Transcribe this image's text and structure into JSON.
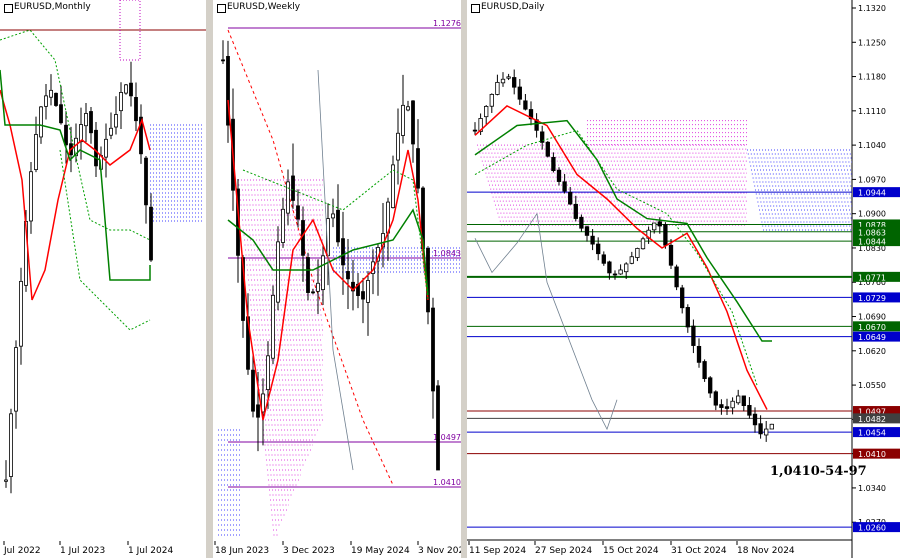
{
  "panels": [
    {
      "id": "monthly",
      "title": "EURUSD,Monthly",
      "x_labels": [
        "Jul 2022",
        "1 Jul 2023",
        "1 Jul 2024"
      ],
      "chart_data": {
        "type": "candlestick",
        "timeframe": "Monthly"
      }
    },
    {
      "id": "weekly",
      "title": "EURUSD,Weekly",
      "x_labels": [
        "18 Jun 2023",
        "3 Dec 2023",
        "19 May 2024",
        "3 Nov 2024"
      ],
      "level_labels": [
        "1.1276",
        "1.0843",
        "1.0497",
        "1.0410"
      ],
      "chart_data": {
        "type": "candlestick",
        "timeframe": "Weekly"
      }
    },
    {
      "id": "daily",
      "title": "EURUSD,Daily",
      "x_labels": [
        "11 Sep 2024",
        "27 Sep 2024",
        "15 Oct 2024",
        "31 Oct 2024",
        "18 Nov 2024"
      ],
      "annotation": "1,0410-54-97",
      "chart_data": {
        "type": "candlestick",
        "timeframe": "Daily",
        "ylim": [
          1.025,
          1.132
        ],
        "y_ticks": [
          "1.1320",
          "1.1250",
          "1.1180",
          "1.1110",
          "1.1040",
          "1.0970",
          "1.0900",
          "1.0830",
          "1.0760",
          "1.0690",
          "1.0620",
          "1.0550",
          "1.0480",
          "1.0410",
          "1.0340",
          "1.0270"
        ],
        "levels": [
          {
            "label": "1.0944",
            "value": 1.0944,
            "color": "#0000cc"
          },
          {
            "label": "1.0878",
            "value": 1.0878,
            "color": "#006400"
          },
          {
            "label": "1.0863",
            "value": 1.0863,
            "color": "#006400"
          },
          {
            "label": "1.0844",
            "value": 1.0844,
            "color": "#006400"
          },
          {
            "label": "1.0771",
            "value": 1.0771,
            "color": "#006400"
          },
          {
            "label": "1.0729",
            "value": 1.0729,
            "color": "#0000cc"
          },
          {
            "label": "1.0670",
            "value": 1.067,
            "color": "#006400"
          },
          {
            "label": "1.0649",
            "value": 1.0649,
            "color": "#0000cc"
          },
          {
            "label": "1.0497",
            "value": 1.0497,
            "color": "#8b0000"
          },
          {
            "label": "1.0482",
            "value": 1.0482,
            "color": "#404040"
          },
          {
            "label": "1.0454",
            "value": 1.0454,
            "color": "#0000cc"
          },
          {
            "label": "1.0410",
            "value": 1.041,
            "color": "#8b0000"
          },
          {
            "label": "1.0260",
            "value": 1.026,
            "color": "#0000cc"
          }
        ]
      }
    }
  ]
}
